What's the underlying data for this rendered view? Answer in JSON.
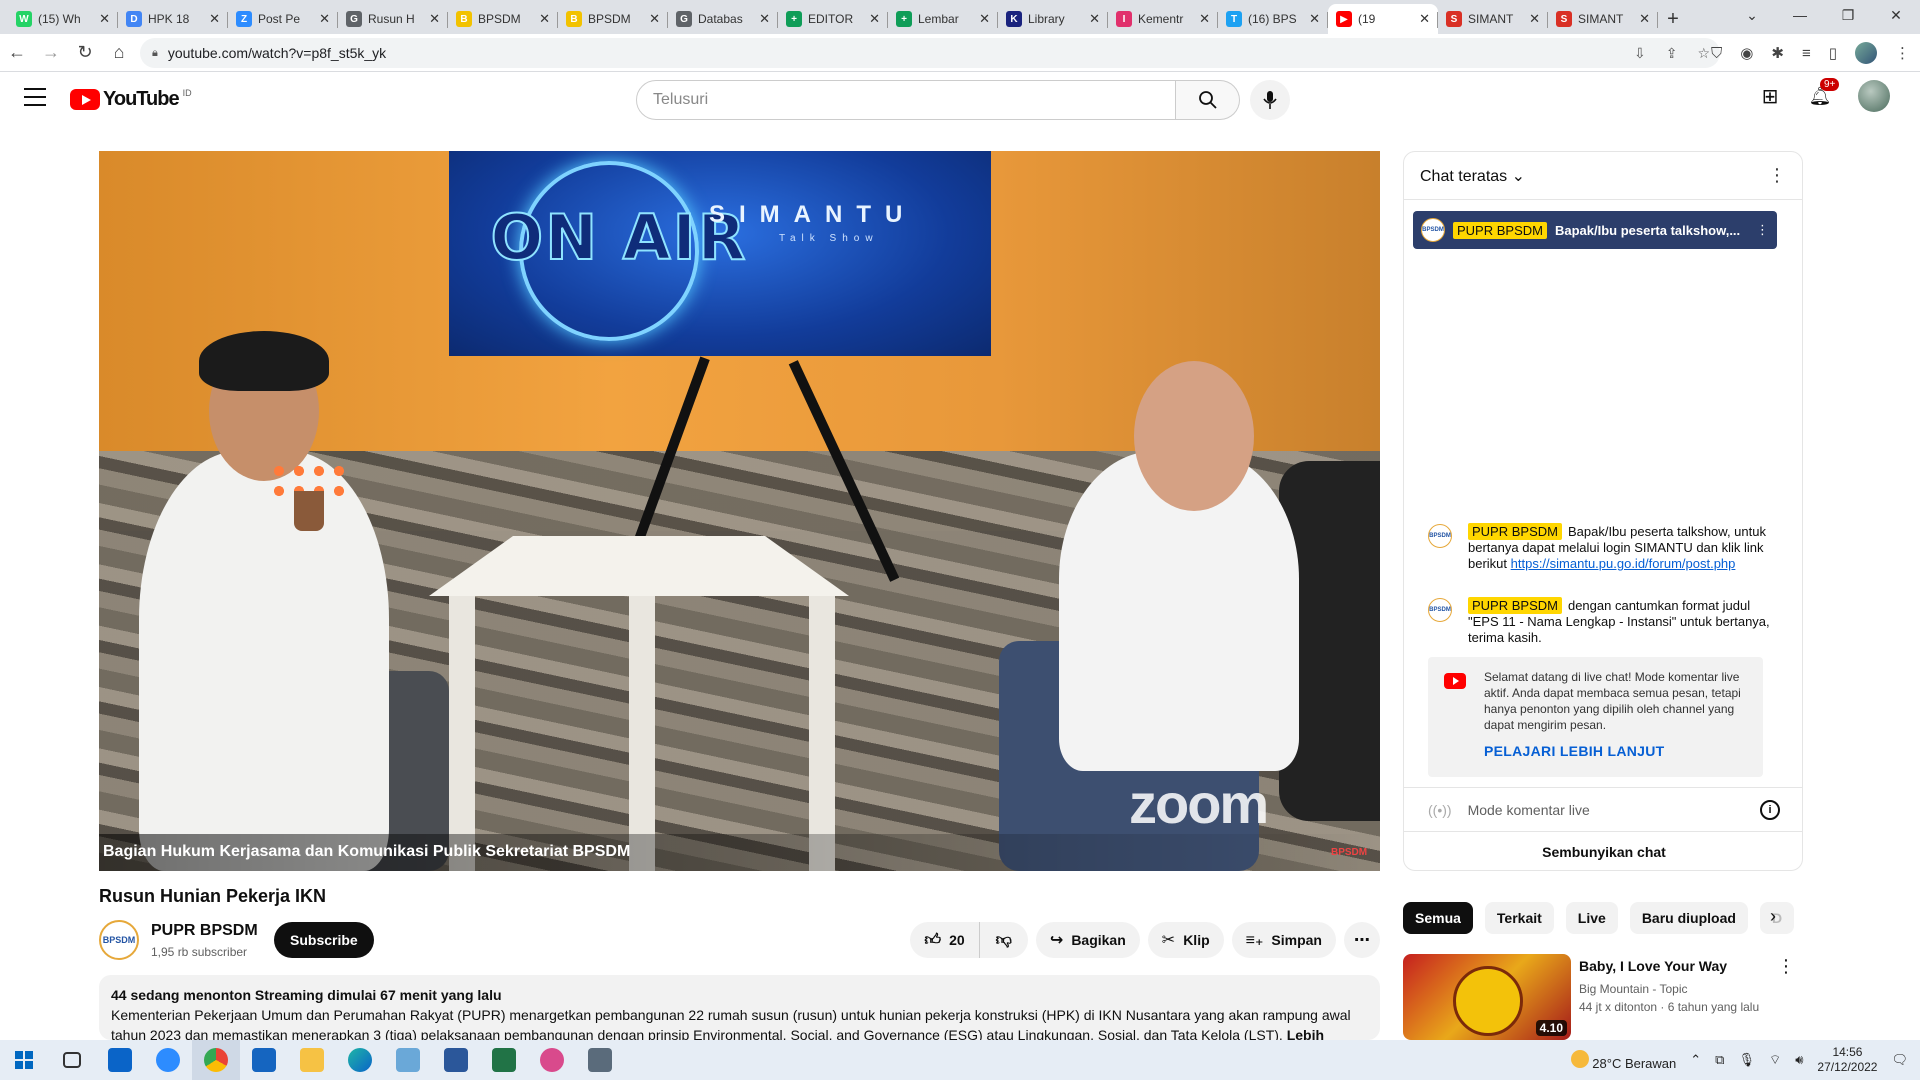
{
  "browser": {
    "tabs": [
      {
        "label": "(15) Wh",
        "color": "#25d366",
        "glyph": "W"
      },
      {
        "label": "HPK 18",
        "color": "#4285f4",
        "glyph": "D"
      },
      {
        "label": "Post Pe",
        "color": "#2d8cff",
        "glyph": "Z"
      },
      {
        "label": "Rusun H",
        "color": "#5f6368",
        "glyph": "G"
      },
      {
        "label": "BPSDM",
        "color": "#f2c200",
        "glyph": "B"
      },
      {
        "label": "BPSDM",
        "color": "#f2c200",
        "glyph": "B"
      },
      {
        "label": "Databas",
        "color": "#5f6368",
        "glyph": "G"
      },
      {
        "label": "EDITOR",
        "color": "#0f9d58",
        "glyph": "+"
      },
      {
        "label": "Lembar",
        "color": "#0f9d58",
        "glyph": "+"
      },
      {
        "label": "Library",
        "color": "#1a237e",
        "glyph": "K"
      },
      {
        "label": "Kementr",
        "color": "#e1306c",
        "glyph": "I"
      },
      {
        "label": "(16) BPS",
        "color": "#1da1f2",
        "glyph": "T"
      },
      {
        "label": "(19",
        "color": "#ff0000",
        "glyph": "▶",
        "active": true
      },
      {
        "label": "SIMANT",
        "color": "#d93025",
        "glyph": "S"
      },
      {
        "label": "SIMANT",
        "color": "#d93025",
        "glyph": "S"
      }
    ],
    "url": "youtube.com/watch?v=p8f_st5k_yk"
  },
  "youtube": {
    "logo_text": "YouTube",
    "region": "ID",
    "search_placeholder": "Telusuri",
    "notification_count": "9+"
  },
  "video": {
    "screen_onair": "ON AIR",
    "screen_brand": "SIMANTU",
    "screen_sub": "Talk Show",
    "watermark": "zoom",
    "logo_corner": "BPSDM",
    "caption": "Bagian Hukum Kerjasama dan Komunikasi Publik Sekretariat BPSDM",
    "title": "Rusun Hunian Pekerja IKN"
  },
  "channel": {
    "avatar_text": "BPSDM",
    "name": "PUPR BPSDM",
    "subscribers": "1,95 rb subscriber",
    "subscribe_label": "Subscribe"
  },
  "actions": {
    "likes": "20",
    "share": "Bagikan",
    "clip": "Klip",
    "save": "Simpan"
  },
  "description": {
    "meta": "44 sedang menonton  Streaming dimulai 67 menit yang lalu",
    "text": "Kementerian Pekerjaan Umum dan Perumahan Rakyat (PUPR) menargetkan pembangunan 22 rumah susun (rusun) untuk hunian pekerja konstruksi (HPK) di IKN Nusantara yang akan rampung awal tahun 2023 dan memastikan menerapkan 3 (tiga) pelaksanaan pembangunan dengan prinsip Environmental, Social, and Governance (ESG) atau Lingkungan, Sosial, dan Tata Kelola (LST).",
    "more": "Lebih banyak"
  },
  "chat": {
    "header": "Chat teratas",
    "pinned_author": "PUPR BPSDM",
    "pinned_text": "Bapak/Ibu peserta talkshow,...",
    "messages": [
      {
        "author": "PUPR BPSDM",
        "text": "Bapak/Ibu peserta talkshow, untuk bertanya dapat melalui login SIMANTU dan klik link berikut ",
        "link": "https://simantu.pu.go.id/forum/post.php"
      },
      {
        "author": "PUPR BPSDM",
        "text": "dengan cantumkan format judul \"EPS 11 - Nama Lengkap - Instansi\" untuk bertanya, terima kasih.",
        "link": ""
      }
    ],
    "welcome": "Selamat datang di live chat! Mode komentar live aktif. Anda dapat membaca semua pesan, tetapi hanya penonton yang dipilih oleh channel yang dapat mengirim pesan.",
    "learn_more": "PELAJARI LEBIH LANJUT",
    "input_mode": "Mode komentar live",
    "hide": "Sembunyikan chat"
  },
  "chips": [
    "Semua",
    "Terkait",
    "Live",
    "Baru diupload",
    "D"
  ],
  "recommendation": {
    "title": "Baby, I Love Your Way",
    "channel": "Big Mountain - Topic",
    "meta": "44 jt x ditonton  ·  6 tahun yang lalu",
    "duration": "4.10"
  },
  "taskbar": {
    "weather": "28°C  Berawan",
    "time": "14:56",
    "date": "27/12/2022"
  }
}
